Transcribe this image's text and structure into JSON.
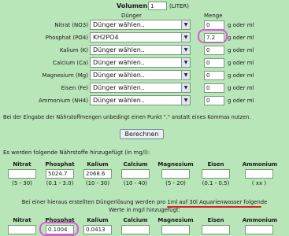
{
  "header": {
    "volumen_label": "Volumen:",
    "volumen_value": "1",
    "volumen_unit": "(LITER)",
    "duenger_label": "Dünger",
    "menge_label": "Menge"
  },
  "rows": [
    {
      "label": "Nitrat (NO3)",
      "select": "Dünger wählen..",
      "menge": "0",
      "unit": "g oder ml"
    },
    {
      "label": "Phosphat (PO4)",
      "select": "KH2PO4",
      "menge": "7.2",
      "unit": "g oder ml"
    },
    {
      "label": "Kalium (K)",
      "select": "Dünger wählen..",
      "menge": "0",
      "unit": "g oder ml"
    },
    {
      "label": "Calcium (Ca)",
      "select": "Dünger wählen..",
      "menge": "0",
      "unit": "g oder ml"
    },
    {
      "label": "Magnesium (Mg)",
      "select": "Dünger wählen..",
      "menge": "0",
      "unit": "g oder ml"
    },
    {
      "label": "Eisen (Fe)",
      "select": "Dünger wählen..",
      "menge": "0",
      "unit": "g oder ml"
    },
    {
      "label": "Ammonium (NH4)",
      "select": "Dünger wählen..",
      "menge": "0",
      "unit": "g oder ml"
    }
  ],
  "note": "Bei der Eingabe der Nährstoffmengen unbedingt einen Punkt \".\" anstatt eines Kommas nutzen.",
  "button_label": "Berechnen",
  "section1": {
    "intro": "Es werden folgende Nährstoffe hinzugefügt (in mg/l):",
    "headers": [
      "Nitrat",
      "Phosphat",
      "Kalium",
      "Calcium",
      "Magnesium",
      "Eisen",
      "Ammonium"
    ],
    "values": [
      "",
      "5024.7",
      "2068.6",
      "",
      "",
      "",
      ""
    ],
    "ranges": [
      "(5 - 30)",
      "(0.1 - 3.0)",
      "(10 - 30)",
      "(10 - 40)",
      "(5 - 20)",
      "(0.1 - 0.5)",
      "( xx )"
    ]
  },
  "section2": {
    "intro_line1": "Bei einer hieraus erstellten Düngerlösung werden pro 1ml auf 30l Aquarienwasser folgende",
    "intro_line2": "Werte in mg/l hinzugefügt:",
    "headers": [
      "Nitrat",
      "Phosphat",
      "Kalium",
      "Calcium",
      "Magnesium",
      "Eisen",
      "Ammonium"
    ],
    "values": [
      "",
      "0.1004",
      "0.0413",
      "",
      "",
      "",
      ""
    ]
  },
  "colors": {
    "background": "#b8e6b8",
    "highlight": "#e056e0",
    "underline": "#e02020"
  }
}
